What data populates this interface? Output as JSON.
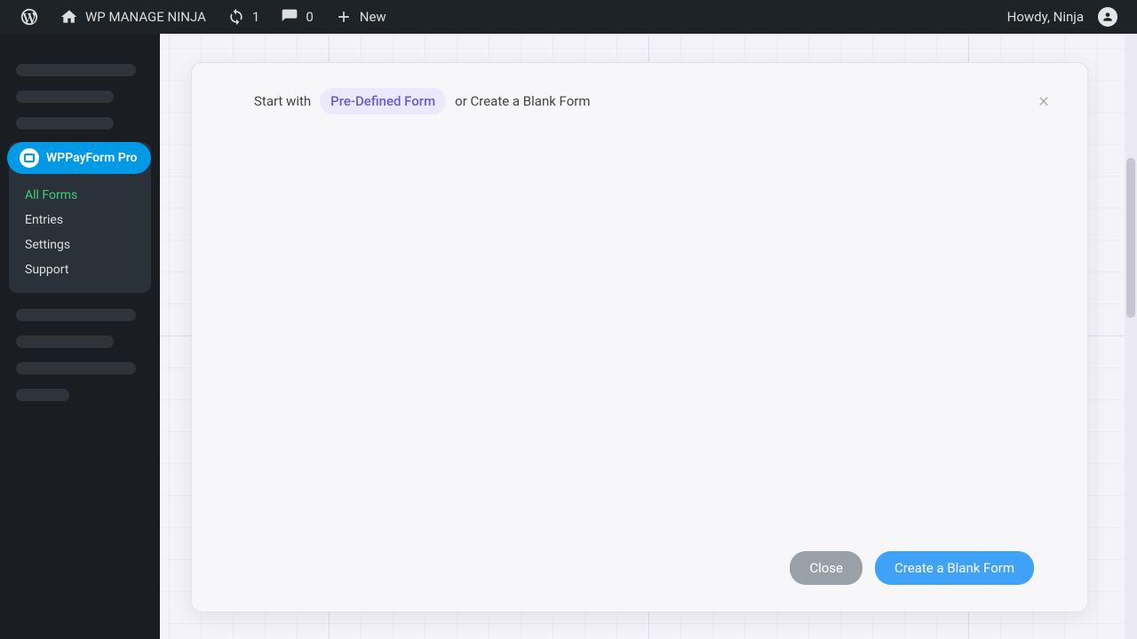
{
  "adminbar": {
    "site_title": "WP MANAGE NINJA",
    "updates_count": "1",
    "comments_count": "0",
    "new_label": "New",
    "howdy": "Howdy, Ninja"
  },
  "sidebar": {
    "plugin_name": "WPPayForm Pro",
    "items": [
      {
        "label": "All Forms",
        "active": true
      },
      {
        "label": "Entries",
        "active": false
      },
      {
        "label": "Settings",
        "active": false
      },
      {
        "label": "Support",
        "active": false
      }
    ]
  },
  "modal": {
    "start_with": "Start with",
    "predefined_pill": "Pre-Defined Form",
    "or_blank": "or Create a Blank Form",
    "close_btn": "Close",
    "create_btn": "Create a Blank Form"
  }
}
